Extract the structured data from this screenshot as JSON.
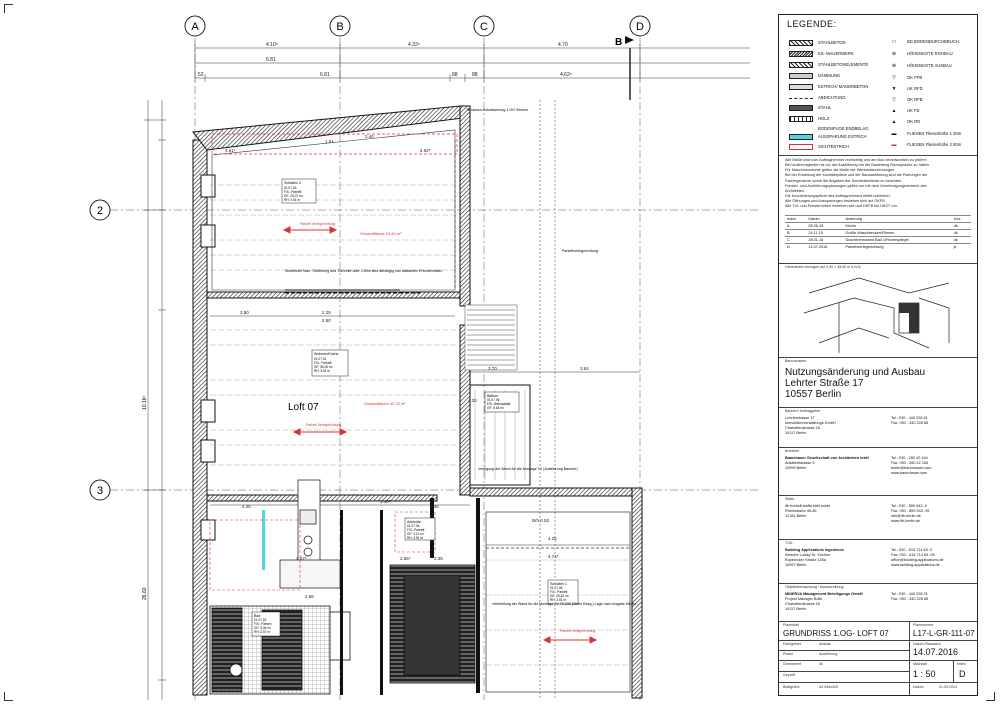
{
  "grid": {
    "columns": [
      "A",
      "B",
      "C",
      "D"
    ],
    "rows": [
      "2",
      "3"
    ],
    "section_mark": "B"
  },
  "dimensions": {
    "top_row1": [
      "4.10⁵",
      "4.32⁵",
      "4.70"
    ],
    "top_row2": [
      "6.81",
      "6.81",
      "4.62⁵"
    ],
    "top_row3": [
      "52",
      "88",
      "88"
    ],
    "left_total": "10.16⁵",
    "left_total2": "26.60",
    "misc": [
      "3.61⁵",
      "2.40",
      "1.51",
      "4.62⁵",
      "2.50",
      "2.25",
      "2.50",
      "3.70",
      "3.62",
      "4.20",
      "1.48⁵",
      "4.25",
      "4.74⁵",
      "4.25",
      "1.36",
      "3.67⁵",
      "2.65⁵",
      "2.56",
      "2.35",
      "Brh 0.53"
    ]
  },
  "rooms": {
    "schlafen2": {
      "title": "Schlafen 2",
      "code": "01.07.03",
      "rows": [
        "F.B.: Parkett",
        "GF: 23.07 m²",
        "RH: 3.51 m"
      ],
      "area": "Gesamtfläche 23.84 m²",
      "parkett": "Parkett Verlegerichtung"
    },
    "wohnen": {
      "title": "Wohnen/Küche",
      "code": "01.07.01",
      "rows": [
        "F.B.: Parkett",
        "GF: 56.00 m²",
        "RH: 3.51 m"
      ],
      "area": "Gesamtfläche 42.70 m²",
      "parkett": "Parkett Verlegerichtung"
    },
    "loft_label": "Loft 07",
    "balkon": {
      "title": "Balkon",
      "code": "01.07.06",
      "rows": [
        "F.B.: Betonplatte",
        "GF: 6.64 m²"
      ]
    },
    "ankleide": {
      "title": "Ankleide",
      "code": "01.07.04",
      "rows": [
        "F.B.: Parkett",
        "GF: 4.12 m²",
        "RH: 3.51 m"
      ]
    },
    "schlafen1": {
      "title": "Schlafen 1",
      "code": "01.07.05",
      "rows": [
        "F.B.: Parkett",
        "GF: 26.20 m²",
        "RH: 3.51 m"
      ],
      "parkett": "Parkett Verlegerichtung"
    },
    "bad": {
      "title": "Bad",
      "code": "01.07.02",
      "rows": [
        "F.B.: Fliesen",
        "GF: 5.46 m²",
        "RH: 2.57 m"
      ]
    },
    "notes": [
      "Terrassen-entwässerung 1.OG Seelore",
      "Schiebetür Max. Türöffnung und Türbreite über 2.50m sind abhängig von statischen Erfordernissen",
      "Verlegung der Wand für die Montage TV (Ausführung Bauherr)",
      "Verkleidung der Wand für die Montage TV 70-240 (Siehe Bezg.) Lage nach Angabe Käufer",
      "Parkettverlegerichtung"
    ]
  },
  "legend": {
    "title": "LEGENDE:",
    "left_items": [
      {
        "label": "STAHLBETON",
        "swatch": "hatch"
      },
      {
        "label": "KS- MAUERWERK",
        "swatch": "hatch2"
      },
      {
        "label": "STAHLBETONELEMENTE",
        "swatch": "hatch"
      },
      {
        "label": "DÄMMUNG",
        "swatch": "dots"
      },
      {
        "label": "ESTRICH/ MAGERBETON",
        "swatch": "light"
      },
      {
        "label": "ABDICHTUNG",
        "swatch": "line"
      },
      {
        "label": "STAHL",
        "swatch": "dark"
      },
      {
        "label": "HOLZ",
        "swatch": "wave"
      },
      {
        "label": "BODENFUGE ENDBELAG",
        "swatch": "plain"
      },
      {
        "label": "AUSSPARUNG ESTRICH",
        "swatch": "cyan"
      },
      {
        "label": "SICHTESTRICH",
        "swatch": "red"
      }
    ],
    "right_items": [
      {
        "label": "BD BODENDURCHBRUCH",
        "symbol": "□"
      },
      {
        "label": "HÖHENKOTE ROHBAU",
        "symbol": "⊕"
      },
      {
        "label": "HÖHENKOTE AUSBAU",
        "symbol": "⊕"
      },
      {
        "label": "OK FFB",
        "symbol": "▽"
      },
      {
        "label": "UK RFD",
        "symbol": "▼"
      },
      {
        "label": "OK RFB",
        "symbol": "▽"
      },
      {
        "label": "UK FD",
        "symbol": "▲"
      },
      {
        "label": "OK RD",
        "symbol": "▲"
      },
      {
        "label": "FLIESEN Fliesenhöhe 1.20m",
        "symbol": "▬"
      },
      {
        "label": "FLIESEN Fliesenhöhe 2.50m",
        "symbol": "▬"
      }
    ]
  },
  "notes_block": [
    "Alle Maße sind vom Auftragnehmer rechtzeitig und am Bau verantwortlich zu prüfen!",
    "Bei Unstimmigkeiten ist vor der Ausführung mit der Bauleitung Rücksprache zu halten.",
    "Für Maschinenräume gelten die Maße der Werkstattzeichnungen.",
    "Bei der Erstellung der Kontaktepläne und der Bauausführung sind die Planungen der",
    "Fachingenieure sowie die Angaben der Sonderfachleute zu beachten.",
    "Fenster- und Ausführungsplanungen gelten nur mit dem Genehmigungsvermerk des",
    "Architekten.",
    "Die Koordinierungspflicht des Auftragnehmers bleibt unberührt.",
    "Alle Öffnungen und Aussparungen beziehen sich auf OKFB.",
    "Alle Tür- und Fensterhöhen beziehen sich auf OKFB bis UKST roh."
  ],
  "revisions": {
    "header": [
      "Index",
      "Datum",
      "Änderung",
      "Gez."
    ],
    "rows": [
      [
        "A",
        "05.06.15",
        "Küche",
        "dk"
      ],
      [
        "B",
        "24.11.15",
        "Größe Waschbecken/Fliesen",
        "dk"
      ],
      [
        "C",
        "28.01.16",
        "Duschtrennwand Bad 1/Flexerspiegel",
        "dk"
      ],
      [
        "D",
        "14.07.2016",
        "Parkettverlegerichtung",
        "je"
      ]
    ]
  },
  "keyplan_label": "Höhenkoten bezogen auf  0.00 = 38.60 m ü.N.N.",
  "project": {
    "label": "Bauvorhaben",
    "title_lines": [
      "Nutzungsänderung und Ausbau",
      "Lehrter Straße 17",
      "10557 Berlin"
    ]
  },
  "parties": [
    {
      "label": "Bauherr/ Auftraggeber",
      "lines": [
        "Lehrterstrasse 17",
        "Immobilienverwaltungs GmbH",
        "Charlottenstrasse 16",
        "10117 Berlin"
      ],
      "contact": [
        "Tel.: 030 - 440 228 51",
        "Fax: 030 - 440 228 88"
      ]
    },
    {
      "label": "Architekt",
      "lines": [
        "Baumhauer Gesellschaft von Architekten mbH",
        "Adalbertstrasse 5",
        "10999 Berlin"
      ],
      "contact": [
        "Tel.: 030 - 280 42 164",
        "Fax: 030 - 280 42 165",
        "",
        "berlin@baumhauer.com",
        "www.baumhauer.com"
      ]
    },
    {
      "label": "Statik",
      "lines": [
        "ifb frohloff staffa kühl ecker",
        "Rheinstraße 45-46",
        "12161 Berlin"
      ],
      "contact": [
        "Tel.: 030 - 859 943 -0",
        "Fax: 030 - 859 943 -99",
        "",
        "info@ifb-berlin.de",
        "www.ifb-berlin.de"
      ]
    },
    {
      "label": "TGA",
      "lines": [
        "Building Applications Ingenieure",
        "Kiesche Lutzky Dr. Krichne",
        "Köpenicker Straße 154a",
        "10997 Berlin"
      ],
      "contact": [
        "Tel.: 030 - 616 714 63 -0",
        "Fax: 030 - 616 714 63 -99",
        "",
        "office@building-applications.de",
        "www.building-applications.de"
      ]
    },
    {
      "label": "Objektüberwachung / Ausschreibung",
      "lines": [
        "MINERVA Management Beteiligungs GmbH",
        "Projekt Manager Bolle",
        "Charlottenstrasse 16",
        "10117 Berlin"
      ],
      "contact": [
        "Tel.: 030 - 440 228 31",
        "Fax: 030 - 440 228 88"
      ]
    }
  ],
  "plan_info": {
    "plan_label": "Planinhalt",
    "plan_title": "GRUNDRISS 1.OG- LOFT 07",
    "number_label": "Plannummer",
    "number": "L17-L-GR-111-07",
    "discipline_label": "Fachgebiet",
    "discipline": "Ausbau",
    "date_label": "Datum Planstand",
    "date": "14.07.2016",
    "phase_label": "Phase",
    "phase": "Ausführung",
    "drawn_label": "Gezeichnet",
    "drawn": "dk",
    "checked_label": "Geprüft",
    "scale_label": "Maßstab",
    "scale": "1 : 50",
    "index_label": "Index",
    "index": "D",
    "size_label": "Blattgröße",
    "size": "A2  594x420",
    "printed_label": "Datum",
    "printed": "01.09.2014"
  }
}
